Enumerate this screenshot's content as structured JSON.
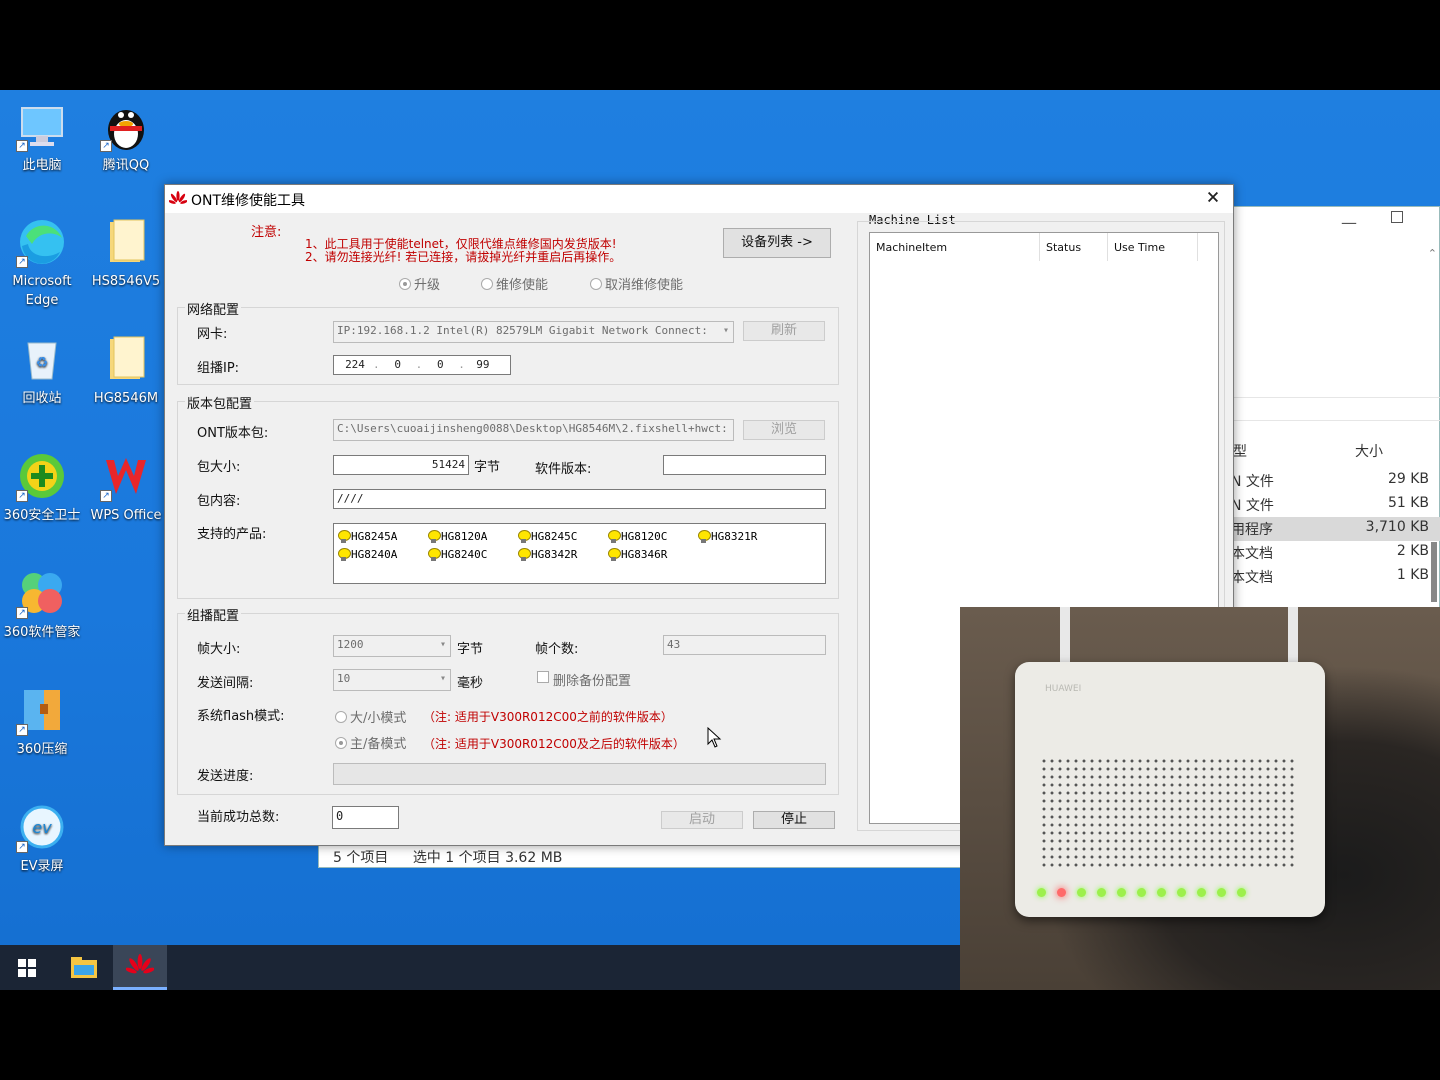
{
  "desktop_icons": [
    {
      "label": "此电脑",
      "icon": "computer-icon"
    },
    {
      "label": "腾讯QQ",
      "icon": "qq-icon"
    },
    {
      "label": "Microsoft Edge",
      "icon": "edge-icon"
    },
    {
      "label": "HS8546V5",
      "icon": "folder-icon"
    },
    {
      "label": "回收站",
      "icon": "recycle-bin-icon"
    },
    {
      "label": "HG8546M",
      "icon": "folder-icon"
    },
    {
      "label": "360安全卫士",
      "icon": "360-security-icon"
    },
    {
      "label": "WPS Office",
      "icon": "wps-icon"
    },
    {
      "label": "360软件管家",
      "icon": "360-software-icon"
    },
    {
      "label": "360压缩",
      "icon": "360-zip-icon"
    },
    {
      "label": "EV录屏",
      "icon": "ev-recorder-icon"
    }
  ],
  "explorer": {
    "column_type": "型",
    "column_size": "大小",
    "rows": [
      {
        "type": "N 文件",
        "size": "29 KB"
      },
      {
        "type": "N 文件",
        "size": "51 KB"
      },
      {
        "type": "用程序",
        "size": "3,710 KB"
      },
      {
        "type": "本文档",
        "size": "2 KB"
      },
      {
        "type": "本文档",
        "size": "1 KB"
      }
    ],
    "status_items": "5 个项目",
    "status_selected": "选中 1 个项目  3.62 MB"
  },
  "dialog": {
    "title": "ONT维修使能工具",
    "notice_label": "注意:",
    "notice_line1": "1、此工具用于使能telnet，仅限代维点维修国内发货版本!",
    "notice_line2": "2、请勿连接光纤! 若已连接，请拔掉光纤并重启后再操作。",
    "device_list_button": "设备列表 ->",
    "mode_upgrade": "升级",
    "mode_repair": "维修使能",
    "mode_cancel": "取消维修使能",
    "network_group": "网络配置",
    "nic_label": "网卡:",
    "nic_value": "IP:192.168.1.2 Intel(R) 82579LM Gigabit Network Connect:",
    "refresh_button": "刷新",
    "multicast_ip_label": "组播IP:",
    "ip_octets": [
      "224",
      "0",
      "0",
      "99"
    ],
    "package_group": "版本包配置",
    "ont_package_label": "ONT版本包:",
    "ont_package_path": "C:\\Users\\cuoaijinsheng0088\\Desktop\\HG8546M\\2.fixshell+hwct:",
    "browse_button": "浏览",
    "size_label": "包大小:",
    "size_value": "51424",
    "size_unit": "字节",
    "software_version_label": "软件版本:",
    "software_version_value": "",
    "content_label": "包内容:",
    "content_value": "////",
    "products_label": "支持的产品:",
    "products": [
      "HG8245A",
      "HG8120A",
      "HG8245C",
      "HG8120C",
      "HG8321R",
      "HG8240A",
      "HG8240C",
      "HG8342R",
      "HG8346R"
    ],
    "multicast_group": "组播配置",
    "frame_size_label": "帧大小:",
    "frame_size_value": "1200",
    "frame_size_unit": "字节",
    "frame_count_label": "帧个数:",
    "frame_count_value": "43",
    "interval_label": "发送间隔:",
    "interval_value": "10",
    "interval_unit": "毫秒",
    "delete_backup_label": "删除备份配置",
    "flash_mode_label": "系统flash模式:",
    "flash_mode_big_small": "大/小模式",
    "flash_mode_big_small_note": "（注: 适用于V300R012C00之前的软件版本）",
    "flash_mode_main_backup": "主/备模式",
    "flash_mode_main_backup_note": "（注: 适用于V300R012C00及之后的软件版本）",
    "progress_label": "发送进度:",
    "progress_value": 0,
    "success_total_label": "当前成功总数:",
    "success_total_value": "0",
    "start_button": "启动",
    "stop_button": "停止",
    "machine_list_title": "Machine List",
    "machine_columns": [
      "MachineItem",
      "Status",
      "Use Time"
    ]
  },
  "camera": {
    "brand": "HUAWEI"
  },
  "colors": {
    "desktop_bg": "#1a78dc",
    "notice_red": "#c00000",
    "taskbar": "#1b2535"
  }
}
